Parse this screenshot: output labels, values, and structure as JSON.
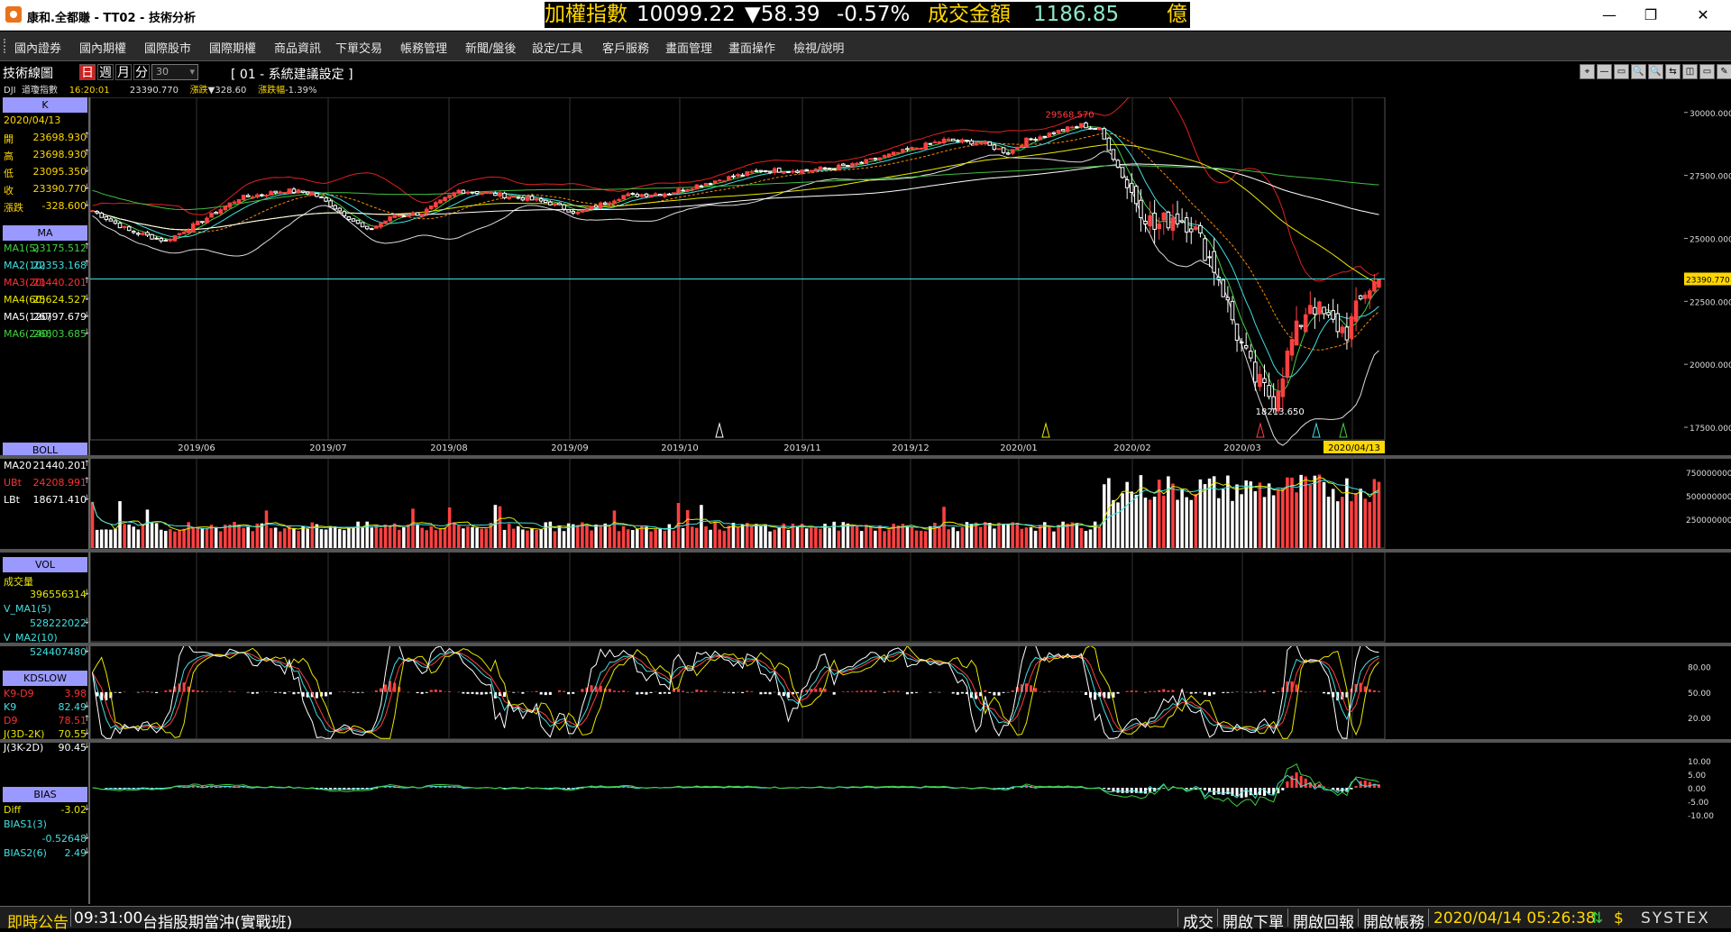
{
  "window": {
    "title": "康和.全都賺 - TT02 - 技術分析",
    "minimize": "—",
    "maximize": "❐",
    "close": "✕"
  },
  "ticker": {
    "index_name": "加權指數",
    "index_value": "10099.22",
    "change": "▼58.39",
    "change_pct": "-0.57%",
    "amount_label": "成交金額",
    "amount": "1186.85",
    "unit": "億",
    "name_color": "#ffd700",
    "down_color": "#ffffff",
    "amount_color": "#8fe8c8"
  },
  "menu": [
    "國內證券",
    "國內期權",
    "國際股市",
    "國際期權",
    "商品資訊",
    "下單交易",
    "帳務管理",
    "新聞/盤後",
    "設定/工具",
    "客戶服務",
    "畫面管理",
    "畫面操作",
    "檢視/說明"
  ],
  "toolbar": {
    "title": "技術線圖",
    "periods": [
      "日",
      "週",
      "月",
      "分"
    ],
    "active_period": "日",
    "minutes": "30",
    "system_setting": "[ 01 - 系統建議設定 ]",
    "symbol": "DJI",
    "symbol_name": "道瓊指數",
    "time": "16:20:01",
    "last": "23390.770",
    "chg_label": "漲跌",
    "chg": "▼328.60",
    "chg_pct_label": "漲跌幅",
    "chg_pct": "-1.39%",
    "tools": [
      "⌖",
      "—",
      "▭",
      "🔍",
      "🔍",
      "⇆",
      "◫",
      "▭",
      "✎"
    ]
  },
  "left_panel": {
    "k": {
      "header": "K",
      "date": "2020/04/13",
      "rows": [
        {
          "name": "開",
          "value": "23698.930",
          "arrow": "↑"
        },
        {
          "name": "高",
          "value": "23698.930",
          "arrow": "↑"
        },
        {
          "name": "低",
          "value": "23095.350",
          "arrow": "↓"
        },
        {
          "name": "收",
          "value": "23390.770",
          "arrow": "↓"
        },
        {
          "name": "漲跌",
          "value": "-328.600",
          "arrow": "↓"
        }
      ]
    },
    "ma": {
      "header": "MA",
      "rows": [
        {
          "name": "MA1(5)",
          "value": "23175.512",
          "arrow": "↑",
          "color": "#40d040"
        },
        {
          "name": "MA2(10)",
          "value": "22353.168",
          "arrow": "↑",
          "color": "#40e0e0"
        },
        {
          "name": "MA3(20)",
          "value": "21440.201",
          "arrow": "↑",
          "color": "#ff3030"
        },
        {
          "name": "MA4(60)",
          "value": "25624.527",
          "arrow": "↓",
          "color": "#e8e800"
        },
        {
          "name": "MA5(120)",
          "value": "26797.679",
          "arrow": "↓",
          "color": "#ffffff"
        },
        {
          "name": "MA6(240)",
          "value": "26603.685",
          "arrow": "↓",
          "color": "#40d040"
        }
      ]
    },
    "boll": {
      "header": "BOLL",
      "rows": [
        {
          "name": "MA20",
          "value": "21440.201",
          "arrow": "↑",
          "color": "#ffffff"
        },
        {
          "name": "UBt",
          "value": "24208.991",
          "arrow": "↑",
          "color": "#ff3030"
        },
        {
          "name": "LBt",
          "value": "18671.410",
          "arrow": "↓",
          "color": "#ffffff"
        }
      ]
    },
    "vol": {
      "header": "VOL",
      "rows": [
        {
          "name": "成交量",
          "value": "",
          "color": "#e8e800"
        },
        {
          "name": "",
          "value": "396556314",
          "arrow": "↓",
          "color": "#e8e800"
        },
        {
          "name": "V_MA1(5)",
          "value": "",
          "color": "#40e0e0"
        },
        {
          "name": "",
          "value": "528222022",
          "arrow": "↓",
          "color": "#40e0e0"
        },
        {
          "name": "V_MA2(10)",
          "value": "",
          "color": "#40e0e0"
        },
        {
          "name": "",
          "value": "524407480",
          "arrow": "↓",
          "color": "#40e0e0"
        }
      ]
    },
    "kd": {
      "header": "KDSLOW",
      "rows": [
        {
          "name": "K9-D9",
          "value": "3.98",
          "color": "#ff3030"
        },
        {
          "name": "K9",
          "value": "82.49",
          "arrow": "↓",
          "color": "#40e0e0"
        },
        {
          "name": "D9",
          "value": "78.51",
          "arrow": "↑",
          "color": "#ff3030"
        },
        {
          "name": "J(3D-2K)",
          "value": "70.55",
          "arrow": "↓",
          "color": "#e8e800"
        },
        {
          "name": "J(3K-2D)",
          "value": "90.45",
          "arrow": "↓",
          "color": "#ffffff"
        }
      ]
    },
    "bias": {
      "header": "BIAS",
      "rows": [
        {
          "name": "Diff",
          "value": "-3.02",
          "arrow": "↓",
          "color": "#e8e800"
        },
        {
          "name": "BIAS1(3)",
          "value": "",
          "color": "#40e0e0"
        },
        {
          "name": "",
          "value": "-0.52648",
          "arrow": "↓",
          "color": "#40e0e0"
        },
        {
          "name": "BIAS2(6)",
          "value": "2.49",
          "arrow": "↓",
          "color": "#40e0e0"
        }
      ]
    }
  },
  "chart_data": {
    "type": "candlestick",
    "symbol": "DJI",
    "last_price": "23390.770",
    "high_label": "29568.570",
    "low_label": "18213.650",
    "cursor_date": "2020/04/13",
    "price_ticks": [
      "30000.000",
      "27500.000",
      "25000.000",
      "22500.000",
      "20000.000",
      "17500.000"
    ],
    "price_range": [
      17000,
      30600
    ],
    "volume_ticks": [
      "750000000",
      "500000000",
      "250000000"
    ],
    "kd_ticks": [
      "80.00",
      "50.00",
      "20.00"
    ],
    "bias_ticks": [
      "10.00",
      "5.00",
      "0.00",
      "-5.00",
      "-10.00"
    ],
    "months": [
      "2019/06",
      "2019/07",
      "2019/08",
      "2019/09",
      "2019/10",
      "2019/11",
      "2019/12",
      "2020/01",
      "2020/02",
      "2020/03",
      "2020"
    ],
    "close_anchors": [
      [
        0,
        26100
      ],
      [
        8,
        25300
      ],
      [
        16,
        24900
      ],
      [
        24,
        25700
      ],
      [
        32,
        26600
      ],
      [
        42,
        26900
      ],
      [
        48,
        26800
      ],
      [
        54,
        26100
      ],
      [
        60,
        25300
      ],
      [
        66,
        25900
      ],
      [
        72,
        26000
      ],
      [
        80,
        26900
      ],
      [
        86,
        26800
      ],
      [
        94,
        26600
      ],
      [
        100,
        26400
      ],
      [
        106,
        26000
      ],
      [
        116,
        26700
      ],
      [
        126,
        26800
      ],
      [
        134,
        27200
      ],
      [
        146,
        27700
      ],
      [
        156,
        27700
      ],
      [
        166,
        27900
      ],
      [
        178,
        28500
      ],
      [
        186,
        28900
      ],
      [
        194,
        28800
      ],
      [
        200,
        28400
      ],
      [
        204,
        28900
      ],
      [
        210,
        29200
      ],
      [
        216,
        29500
      ],
      [
        220,
        29300
      ],
      [
        226,
        27100
      ],
      [
        232,
        25400
      ],
      [
        236,
        25900
      ],
      [
        240,
        25600
      ],
      [
        246,
        23500
      ],
      [
        250,
        21200
      ],
      [
        254,
        19400
      ],
      [
        258,
        18600
      ],
      [
        262,
        20900
      ],
      [
        266,
        22500
      ],
      [
        270,
        21700
      ],
      [
        274,
        21300
      ],
      [
        278,
        22900
      ],
      [
        281,
        23390
      ]
    ]
  },
  "status": {
    "news_label": "即時公告",
    "news_time": "09:31:00",
    "news_text": "台指股期當沖(實戰班)",
    "btn_trades": "成交",
    "btn_order": "開啟下單",
    "btn_report": "開啟回報",
    "btn_account": "開啟帳務",
    "datetime": "2020/04/14 05:26:38",
    "brand": "SYSTEX"
  }
}
